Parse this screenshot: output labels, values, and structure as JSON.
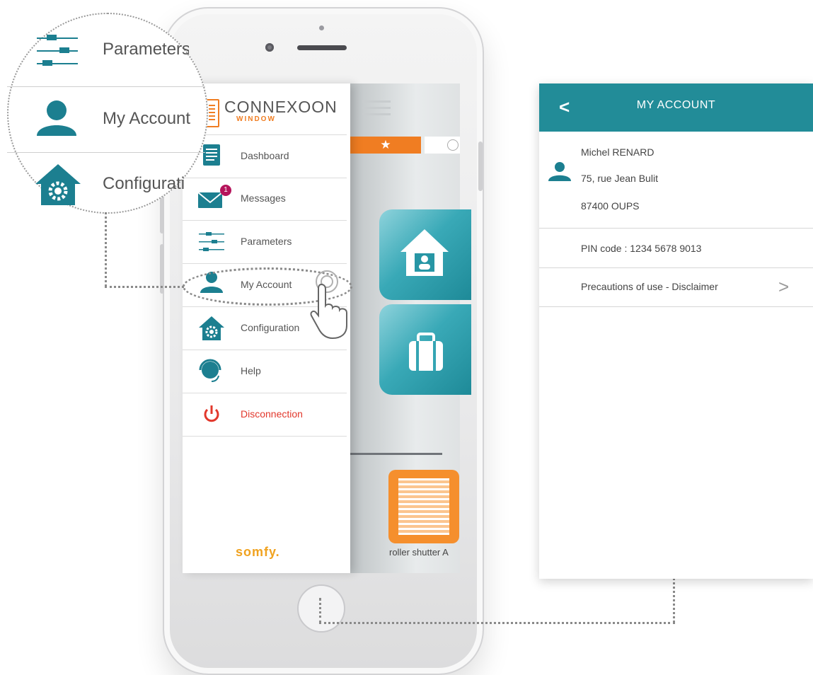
{
  "menu": {
    "logo": {
      "brand": "CONNEXOON",
      "product": "WINDOW"
    },
    "items": [
      {
        "label": "Dashboard",
        "icon": "dashboard-icon"
      },
      {
        "label": "Messages",
        "icon": "envelope-icon",
        "badge": "1"
      },
      {
        "label": "Parameters",
        "icon": "sliders-icon"
      },
      {
        "label": "My Account",
        "icon": "user-icon"
      },
      {
        "label": "Configuration",
        "icon": "house-gear-icon"
      },
      {
        "label": "Help",
        "icon": "headset-icon"
      },
      {
        "label": "Disconnection",
        "icon": "power-icon"
      }
    ],
    "footer_logo": "somfy."
  },
  "zoom": {
    "items": [
      "Parameters",
      "My Account",
      "Configuration"
    ]
  },
  "app": {
    "device_label": "roller shutter A"
  },
  "account": {
    "title": "MY ACCOUNT",
    "name": "Michel RENARD",
    "address": "75, rue Jean Bulit",
    "city": "87400 OUPS",
    "pin": "PIN code : 1234 5678 9013",
    "disclaimer": "Precautions of use - Disclaimer"
  },
  "colors": {
    "teal": "#228c98",
    "orange": "#f07d22",
    "red": "#e2382c",
    "badge": "#b5145b"
  }
}
